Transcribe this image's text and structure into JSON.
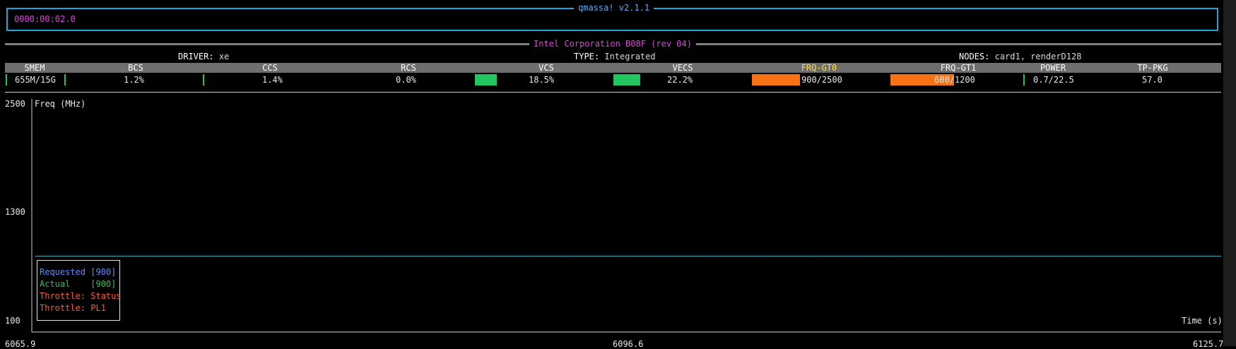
{
  "app": {
    "title": "qmassa! v2.1.1",
    "device_address": "0000:00:02.0"
  },
  "device": {
    "title": "Intel Corporation B08F (rev 04)",
    "driver_label": "DRIVER:",
    "driver_value": "xe",
    "type_label": "TYPE:",
    "type_value": "Integrated",
    "nodes_label": "NODES:",
    "nodes_value": "card1, renderD128"
  },
  "stats": {
    "headers": [
      "SMEM",
      "BCS",
      "CCS",
      "RCS",
      "VCS",
      "VECS",
      "FRQ-GT0",
      "FRQ-GT1",
      "POWER",
      "TP-PKG"
    ],
    "values": {
      "smem": "655M/15G",
      "bcs": "1.2%",
      "ccs": "1.4%",
      "rcs": "0.0%",
      "vcs": "18.5%",
      "vecs": "22.2%",
      "frq_gt0": "900/2500",
      "frq_gt1_a": "600",
      "frq_gt1_b": "/1200",
      "power": "0.7/22.5",
      "tp_pkg": "57.0"
    },
    "bars": {
      "vcs_fraction": 0.185,
      "vecs_fraction": 0.222,
      "frq_gt0_fraction": 0.36,
      "frq_gt1_fraction": 0.5
    },
    "colors": {
      "bar_green": "#22c55e",
      "bar_orange": "#f97316",
      "highlight_header": "#ffe14a"
    }
  },
  "chart_data": {
    "type": "line",
    "title": "Freq (MHz)",
    "xlabel": "Time (s)",
    "ylabel": "Freq (MHz)",
    "y_ticks": [
      "2500",
      "1300",
      "100"
    ],
    "x_ticks": [
      "6065.9",
      "6096.6",
      "6125.7"
    ],
    "ylim": [
      100,
      2500
    ],
    "xlim": [
      6065.9,
      6125.7
    ],
    "series": [
      {
        "name": "Requested [900]",
        "color": "#5b8cff",
        "x": [
          6065.9,
          6125.7
        ],
        "values": [
          900,
          900
        ]
      },
      {
        "name": "Actual    [900]",
        "color": "#22c55e",
        "x": [
          6065.9,
          6125.7
        ],
        "values": [
          900,
          900
        ]
      },
      {
        "name": "Throttle: Status",
        "color": "#ff5a36",
        "x": [],
        "values": []
      },
      {
        "name": "Throttle: PL1",
        "color": "#ff5a36",
        "x": [],
        "values": []
      }
    ],
    "legend_position": "bottom-left",
    "grid": false
  }
}
